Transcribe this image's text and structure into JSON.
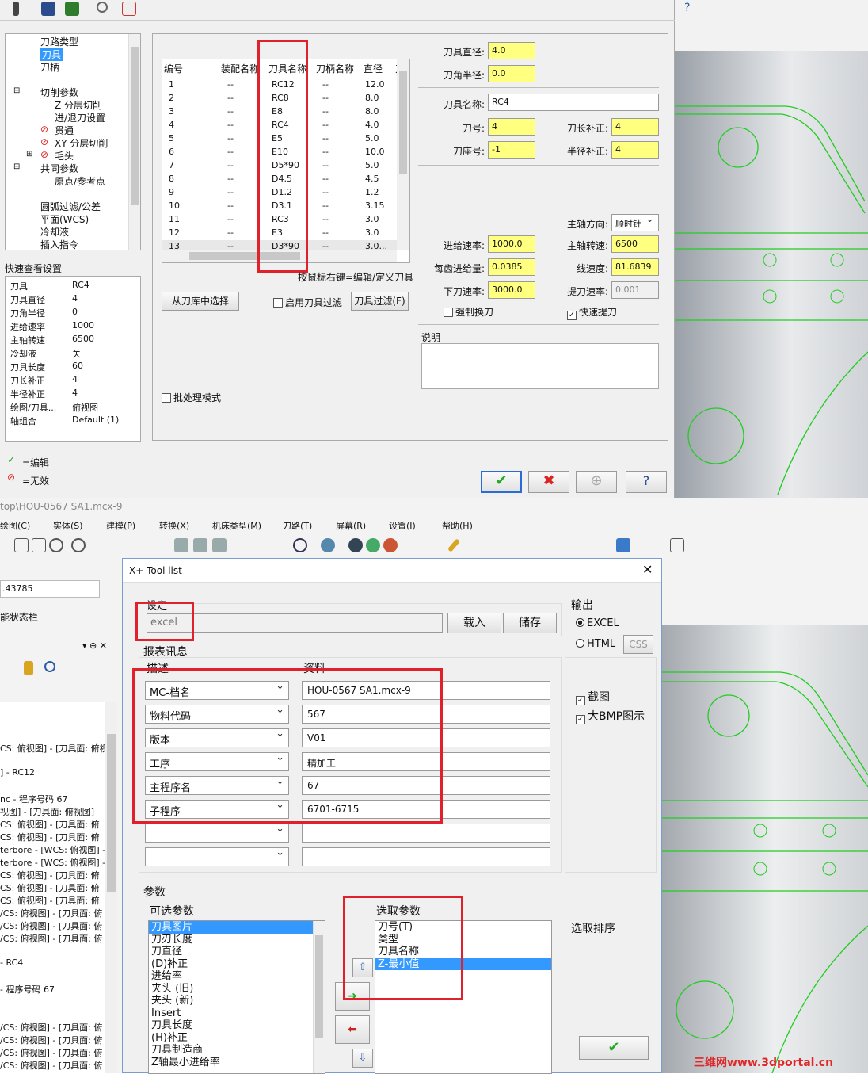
{
  "top_dialog": {
    "tree": [
      "刀路类型",
      "刀具",
      "刀柄",
      "切削参数",
      "Z 分层切削",
      "进/退刀设置",
      "贯通",
      "XY 分层切削",
      "毛头",
      "共同参数",
      "原点/参考点",
      "圆弧过滤/公差",
      "平面(WCS)",
      "冷却液",
      "插入指令"
    ],
    "quick_title": "快速查看设置",
    "quick": [
      [
        "刀具",
        "RC4"
      ],
      [
        "刀具直径",
        "4"
      ],
      [
        "刀角半径",
        "0"
      ],
      [
        "进给速率",
        "1000"
      ],
      [
        "主轴转速",
        "6500"
      ],
      [
        "冷却液",
        "关"
      ],
      [
        "刀具长度",
        "60"
      ],
      [
        "刀长补正",
        "4"
      ],
      [
        "半径补正",
        "4"
      ],
      [
        "绘图/刀具...",
        "俯视图"
      ],
      [
        "轴组合",
        "Default (1)"
      ]
    ],
    "legend_edit": "=编辑",
    "legend_invalid": "=无效",
    "table_headers": [
      "编号",
      "装配名称",
      "刀具名称",
      "刀柄名称",
      "直径",
      "刀"
    ],
    "table_rows": [
      [
        "1",
        "--",
        "RC12",
        "--",
        "12.0"
      ],
      [
        "2",
        "--",
        "RC8",
        "--",
        "8.0"
      ],
      [
        "3",
        "--",
        "E8",
        "--",
        "8.0"
      ],
      [
        "4",
        "--",
        "RC4",
        "--",
        "4.0"
      ],
      [
        "5",
        "--",
        "E5",
        "--",
        "5.0"
      ],
      [
        "6",
        "--",
        "E10",
        "--",
        "10.0"
      ],
      [
        "7",
        "--",
        "D5*90",
        "--",
        "5.0"
      ],
      [
        "8",
        "--",
        "D4.5",
        "--",
        "4.5"
      ],
      [
        "9",
        "--",
        "D1.2",
        "--",
        "1.2"
      ],
      [
        "10",
        "--",
        "D3.1",
        "--",
        "3.15"
      ],
      [
        "11",
        "--",
        "RC3",
        "--",
        "3.0"
      ],
      [
        "12",
        "--",
        "E3",
        "--",
        "3.0"
      ],
      [
        "13",
        "--",
        "D3*90",
        "--",
        "3.0..."
      ]
    ],
    "table_hint": "按鼠标右键=编辑/定义刀具",
    "btn_library": "从刀库中选择",
    "chk_filter": "启用刀具过滤",
    "btn_filter": "刀具过滤(F)",
    "chk_batch": "批处理模式",
    "lbl_diameter": "刀具直径:",
    "val_diameter": "4.0",
    "lbl_radius": "刀角半径:",
    "val_radius": "0.0",
    "lbl_toolname": "刀具名称:",
    "val_toolname": "RC4",
    "lbl_toolno": "刀号:",
    "val_toolno": "4",
    "lbl_lencomp": "刀长补正:",
    "val_lencomp": "4",
    "lbl_holder": "刀座号:",
    "val_holder": "-1",
    "lbl_radcomp": "半径补正:",
    "val_radcomp": "4",
    "lbl_spindir": "主轴方向:",
    "val_spindir": "顺时针",
    "lbl_feed": "进给速率:",
    "val_feed": "1000.0",
    "lbl_rpm": "主轴转速:",
    "val_rpm": "6500",
    "lbl_fpt": "每齿进给量:",
    "val_fpt": "0.0385",
    "lbl_surface": "线速度:",
    "val_surface": "81.6839",
    "lbl_plunge": "下刀速率:",
    "val_plunge": "3000.0",
    "lbl_retract": "提刀速率:",
    "val_retract": "0.001",
    "chk_force": "强制换刀",
    "chk_rapid": "快速提刀",
    "lbl_note": "说明"
  },
  "titlebar_path": "top\\HOU-0567 SA1.mcx-9",
  "menu": [
    "绘图(C)",
    "实体(S)",
    "建模(P)",
    "转换(X)",
    "机床类型(M)",
    "刀路(T)",
    "屏幕(R)",
    "设置(I)",
    "帮助(H)"
  ],
  "left_value": ".43785",
  "left_status": "能状态栏",
  "left_ops": [
    "CS: 俯视图] - [刀具面: 俯视",
    "] - RC12",
    "nc - 程序号码 67",
    "视图] - [刀具面: 俯视图]",
    "CS: 俯视图] - [刀具面: 俯",
    "CS: 俯视图] - [刀具面: 俯",
    "terbore - [WCS: 俯视图] - [",
    "terbore - [WCS: 俯视图] - [",
    "CS: 俯视图] - [刀具面: 俯",
    "CS: 俯视图] - [刀具面: 俯",
    "CS: 俯视图] - [刀具面: 俯",
    "/CS: 俯视图] - [刀具面: 俯",
    "/CS: 俯视图] - [刀具面: 俯",
    "/CS: 俯视图] - [刀具面: 俯",
    "- RC4",
    "- 程序号码 67",
    "/CS: 俯视图] - [刀具面: 俯",
    "/CS: 俯视图] - [刀具面: 俯",
    "/CS: 俯视图] - [刀具面: 俯",
    "/CS: 俯视图] - [刀具面: 俯"
  ],
  "tool_list": {
    "title": "X+ Tool list",
    "settings_label": "设定",
    "settings_value": "excel",
    "btn_load": "载入",
    "btn_save": "储存",
    "output_label": "输出",
    "radio_excel": "EXCEL",
    "radio_html": "HTML",
    "btn_css": "CSS",
    "report_label": "报表讯息",
    "col_desc": "描述",
    "col_data": "资料",
    "rows": [
      [
        "MC-档名",
        "HOU-0567 SA1.mcx-9"
      ],
      [
        "物料代码",
        "567"
      ],
      [
        "版本",
        "V01"
      ],
      [
        "工序",
        "精加工"
      ],
      [
        "主程序名",
        "67"
      ],
      [
        "子程序",
        "6701-6715"
      ],
      [
        "",
        ""
      ],
      [
        "",
        ""
      ]
    ],
    "chk_screenshot": "截图",
    "chk_bigbmp": "大BMP图示",
    "params_label": "参数",
    "avail_label": "可选参数",
    "avail": [
      "刀具图片",
      "刀刃长度",
      "刀直径",
      "(D)补正",
      "进给率",
      "夹头 (旧)",
      "夹头 (新)",
      "Insert",
      "刀具长度",
      "(H)补正",
      "刀具制造商",
      "Z轴最小进给率"
    ],
    "selected_label": "选取参数",
    "selected": [
      "刀号(T)",
      "类型",
      "刀具名称",
      "Z-最小值"
    ],
    "sort_label": "选取排序"
  },
  "watermark": "三维网www.3dportal.cn",
  "colors": {
    "accent": "#3399ff",
    "highlight": "#e0202a",
    "yellow": "#ffff80",
    "cad_green": "#22cc22"
  }
}
